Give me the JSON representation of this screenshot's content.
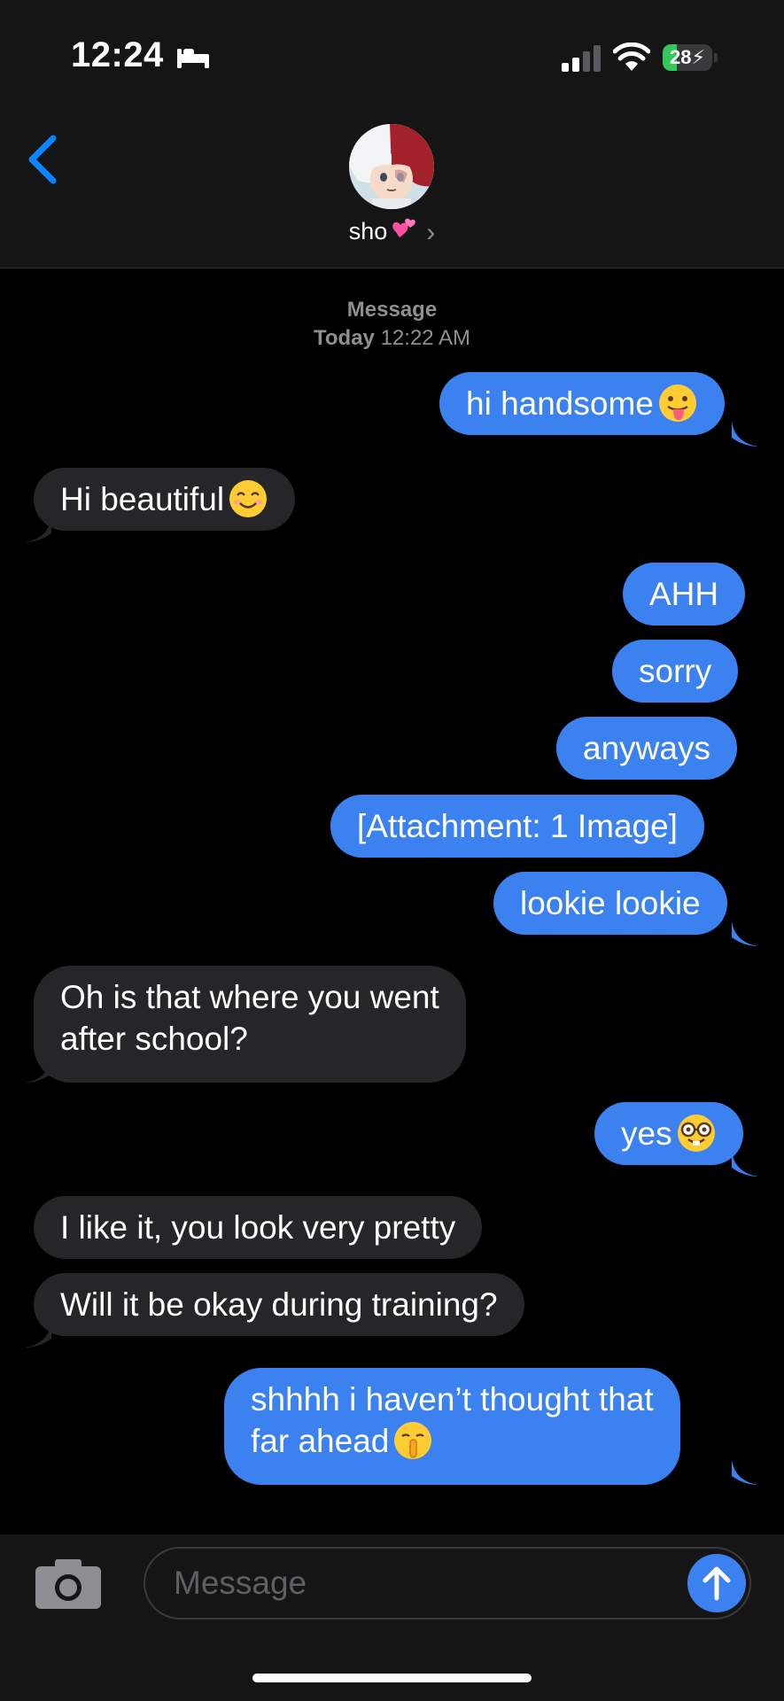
{
  "status_bar": {
    "time": "12:24",
    "focus_icon": "bed-icon",
    "battery_percent": "28",
    "battery_level": 0.28,
    "battery_state": "charging"
  },
  "header": {
    "back_icon": "chevron-left-icon",
    "contact_name": "sho",
    "name_emoji": "two-hearts-emoji",
    "accent_color": "#0a84ff"
  },
  "thread": {
    "service_label": "Message",
    "date_label": "Today",
    "time_label": "12:22 AM"
  },
  "messages": [
    {
      "dir": "out",
      "text": "hi handsome",
      "emoji": "tongue-face-emoji"
    },
    {
      "dir": "in",
      "text": "Hi beautiful",
      "emoji": "smiling-face-emoji"
    },
    {
      "dir": "out",
      "text": "AHH"
    },
    {
      "dir": "out",
      "text": "sorry"
    },
    {
      "dir": "out",
      "text": "anyways"
    },
    {
      "dir": "out",
      "text": "[Attachment: 1 Image]"
    },
    {
      "dir": "out",
      "text": "lookie lookie"
    },
    {
      "dir": "in",
      "line1": "Oh is that where you went",
      "line2": "after school?"
    },
    {
      "dir": "out",
      "text": "yes",
      "emoji": "nerd-face-emoji"
    },
    {
      "dir": "in",
      "text": "I like it, you look very pretty"
    },
    {
      "dir": "in",
      "text": "Will it be okay during training?"
    },
    {
      "dir": "out",
      "line1": "shhhh i haven’t thought that",
      "line2": "far ahead",
      "emoji": "shushing-face-emoji"
    }
  ],
  "compose": {
    "placeholder": "Message",
    "camera_icon": "camera-icon",
    "send_icon": "arrow-up-icon"
  },
  "colors": {
    "outgoing_bubble": "#3b82f0",
    "incoming_bubble": "#262629",
    "background": "#000000",
    "secondary_text": "#8e8e93"
  }
}
